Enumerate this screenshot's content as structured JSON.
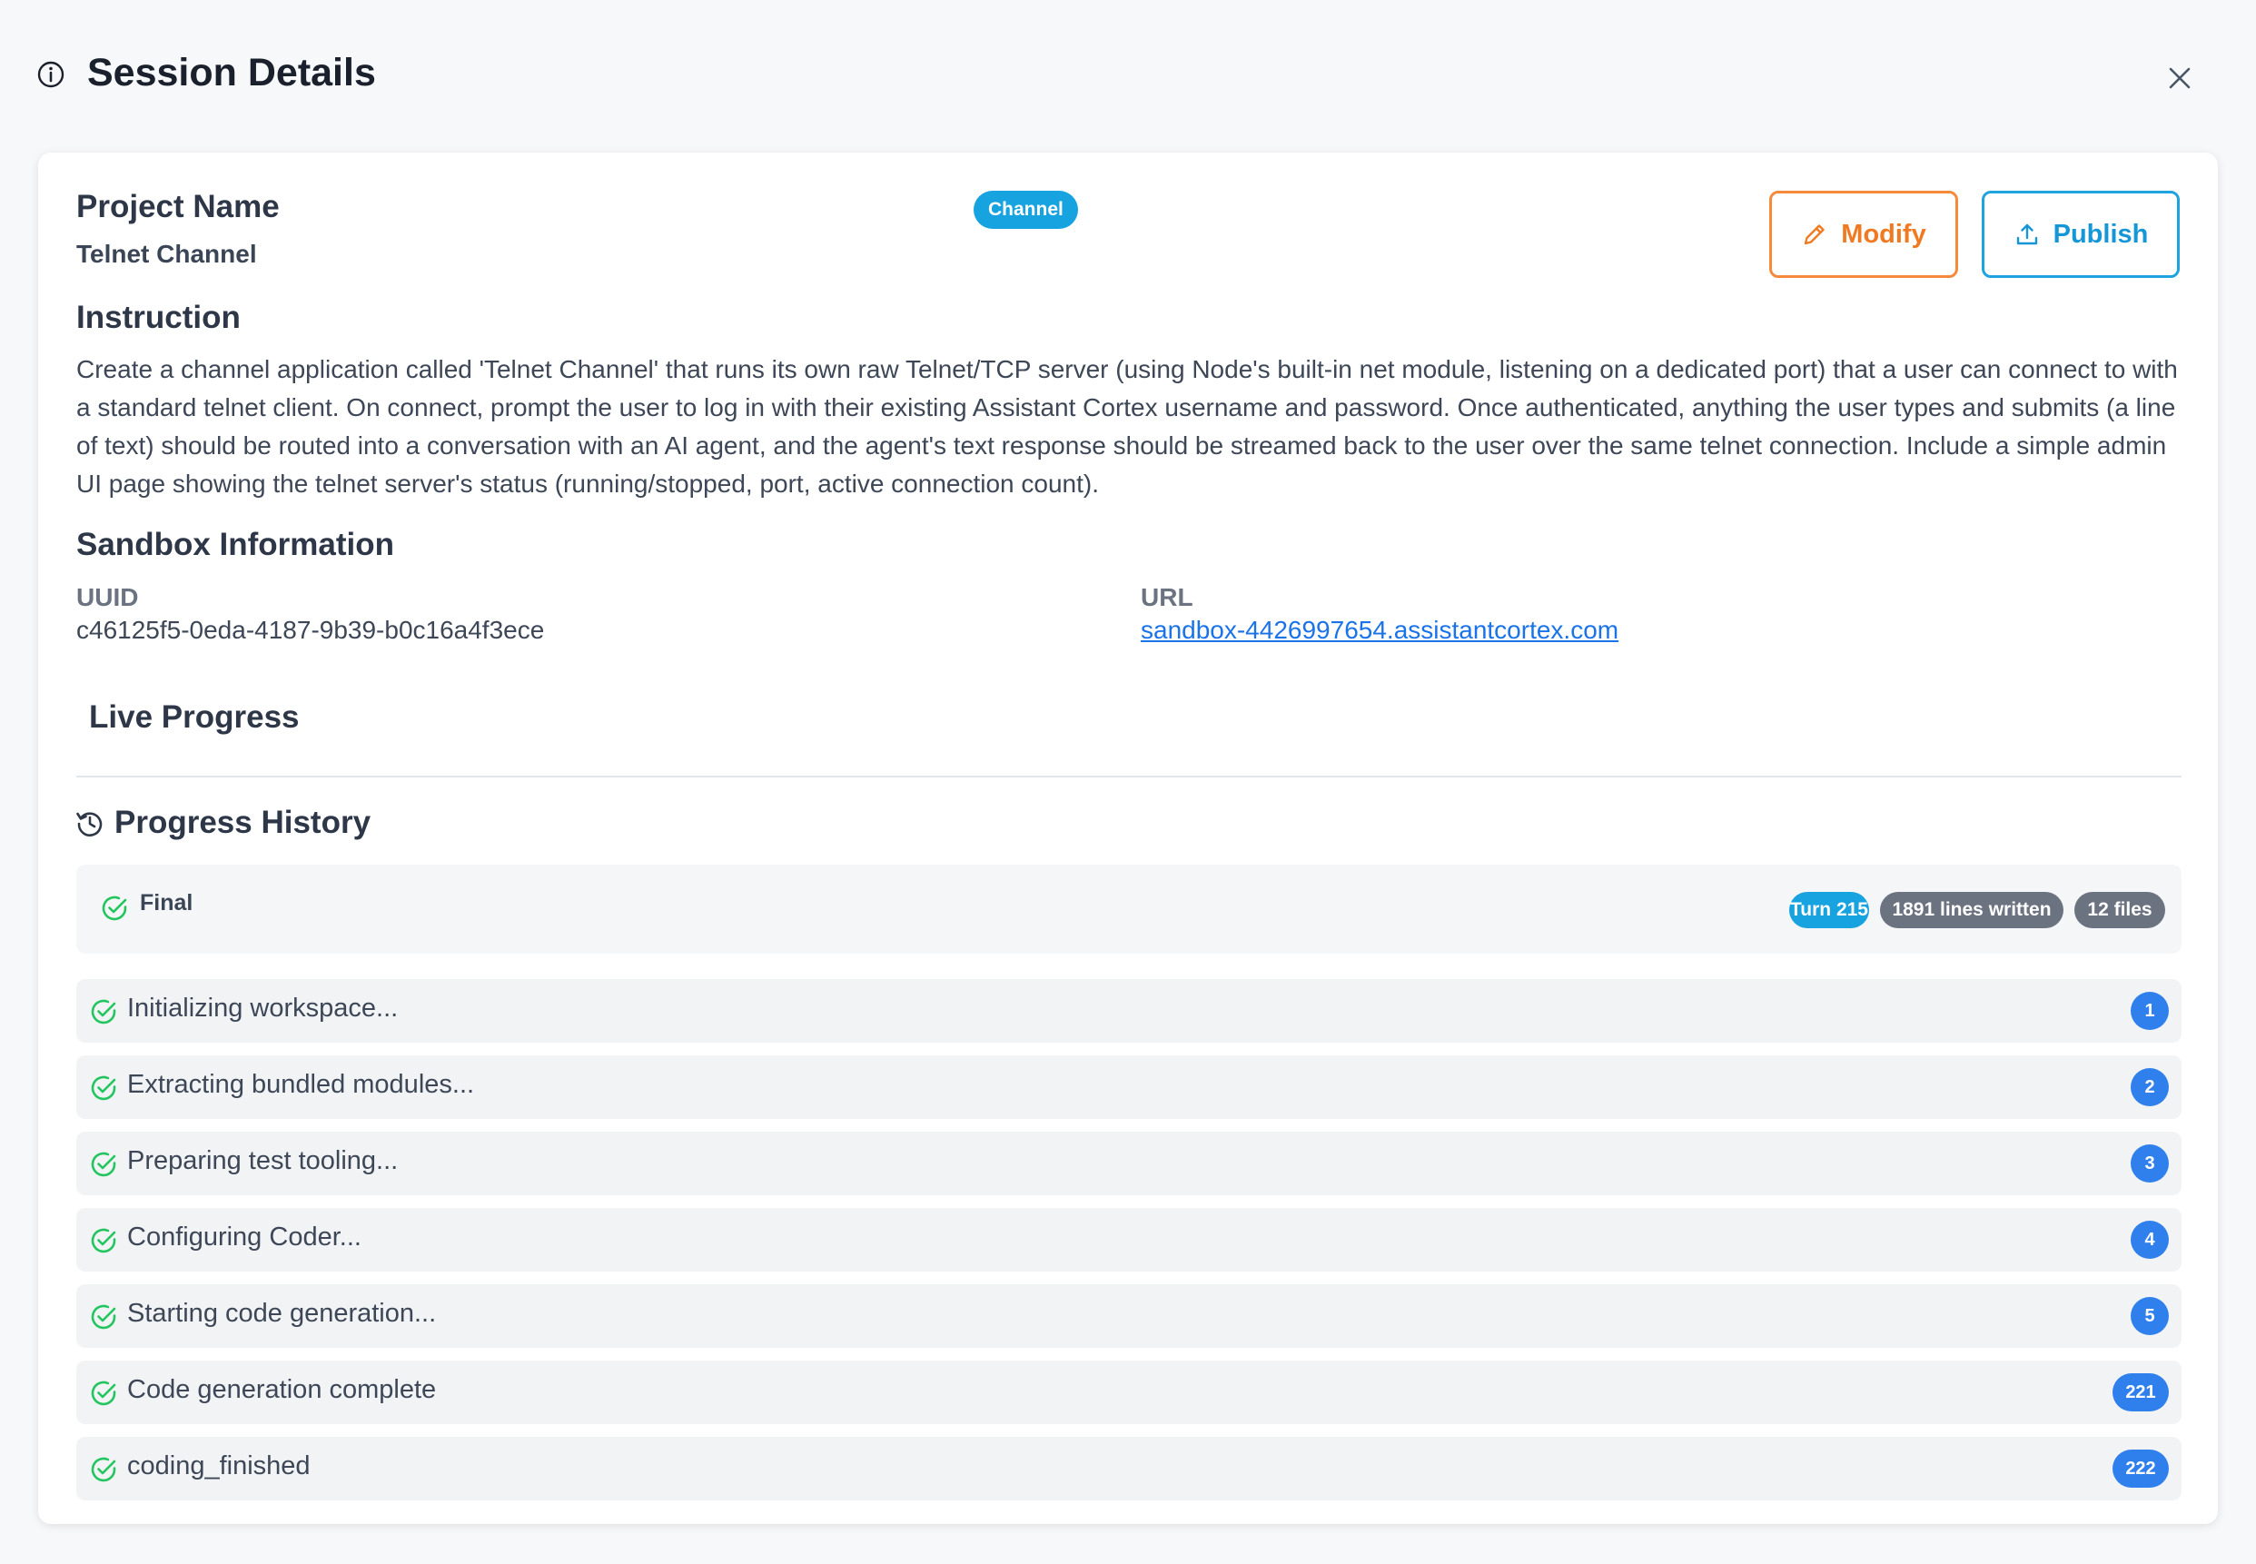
{
  "header": {
    "title": "Session Details"
  },
  "project": {
    "name_label": "Project Name",
    "name_value": "Telnet Channel",
    "badge": "Channel"
  },
  "actions": {
    "modify_label": "Modify",
    "publish_label": "Publish"
  },
  "instruction": {
    "label": "Instruction",
    "text": "Create a channel application called 'Telnet Channel' that runs its own raw Telnet/TCP server (using Node's built-in net module, listening on a dedicated port) that a user can connect to with a standard telnet client. On connect, prompt the user to log in with their existing Assistant Cortex username and password. Once authenticated, anything the user types and submits (a line of text) should be routed into a conversation with an AI agent, and the agent's text response should be streamed back to the user over the same telnet connection. Include a simple admin UI page showing the telnet server's status (running/stopped, port, active connection count)."
  },
  "sandbox": {
    "label": "Sandbox Information",
    "uuid_label": "UUID",
    "uuid_value": "c46125f5-0eda-4187-9b39-b0c16a4f3ece",
    "url_label": "URL",
    "url_value": "sandbox-4426997654.assistantcortex.com"
  },
  "live_progress": {
    "label": "Live Progress"
  },
  "history": {
    "label": "Progress History",
    "final": {
      "label": "Final",
      "turn": "Turn 215",
      "lines": "1891 lines written",
      "files": "12 files"
    },
    "steps": [
      {
        "text": "Initializing workspace...",
        "num": "1"
      },
      {
        "text": "Extracting bundled modules...",
        "num": "2"
      },
      {
        "text": "Preparing test tooling...",
        "num": "3"
      },
      {
        "text": "Configuring Coder...",
        "num": "4"
      },
      {
        "text": "Starting code generation...",
        "num": "5"
      },
      {
        "text": "Code generation complete",
        "num": "221"
      },
      {
        "text": "coding_finished",
        "num": "222"
      }
    ]
  },
  "colors": {
    "accent_blue": "#17a2e0",
    "modify_orange": "#f07a22",
    "step_number_blue": "#2f80ed",
    "success_green": "#22c55e",
    "neutral_pill": "#6b7280"
  },
  "icons": {
    "header": "info-icon",
    "close": "close-icon",
    "modify": "pencil-icon",
    "publish": "upload-icon",
    "history": "history-icon",
    "step": "check-circle-icon"
  }
}
